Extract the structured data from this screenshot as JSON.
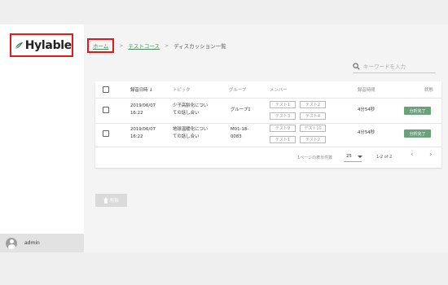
{
  "brand": {
    "name": "Hylable",
    "accent": "#2e7d4f"
  },
  "user": {
    "name": "admin",
    "icon": "account-circle-icon"
  },
  "breadcrumb": {
    "home": "ホーム",
    "separator": ">",
    "course": "テストコース",
    "current": "ディスカッション一覧"
  },
  "search": {
    "placeholder": "キーワードを入力",
    "value": "",
    "icon": "search-icon"
  },
  "table": {
    "headers": {
      "date": "録音日時",
      "sort_indicator": "↓",
      "topic": "トピック",
      "group": "グループ",
      "members": "メンバー",
      "duration": "録音時間",
      "status": "状態"
    },
    "rows": [
      {
        "date_line1": "2019/06/07",
        "date_line2": "16:22",
        "topic_line1": "少子高齢化につい",
        "topic_line2": "ての話し合い",
        "group_line1": "グループ1",
        "group_line2": "",
        "members": [
          "テスト1",
          "テスト2",
          "テスト3",
          "テスト4"
        ],
        "duration": "4分54秒",
        "status": "分析完了"
      },
      {
        "date_line1": "2019/06/07",
        "date_line2": "16:22",
        "topic_line1": "地球温暖化につい",
        "topic_line2": "ての話し合い",
        "group_line1": "M01-18-",
        "group_line2": "0083",
        "members": [
          "テスト9",
          "テスト10",
          "テスト1",
          "テスト2"
        ],
        "duration": "4分54秒",
        "status": "分析完了"
      }
    ],
    "footer": {
      "rows_per_page_label": "1ページの表示件数",
      "rows_per_page": "25",
      "range": "1-2 of 2",
      "prev": "‹",
      "next": "›"
    }
  },
  "actions": {
    "delete": "削除",
    "delete_icon": "trash-icon"
  },
  "colors": {
    "status_badge": "#6aa07a",
    "link": "#4a8c5f",
    "highlight_border": "#e01b1b"
  }
}
